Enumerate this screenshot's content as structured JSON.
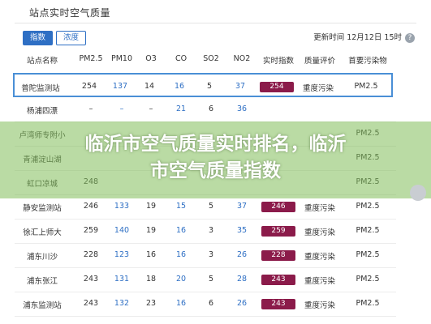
{
  "header": {
    "title": "站点实时空气质量",
    "update_time": "更新时间 12月12日 15时",
    "help_icon": "?"
  },
  "tabs": [
    {
      "label": "指数",
      "active": true
    },
    {
      "label": "浓度",
      "active": false
    }
  ],
  "table": {
    "columns": [
      "站点名称",
      "PM2.5",
      "PM10",
      "O3",
      "CO",
      "SO2",
      "NO2",
      "实时指数",
      "质量评价",
      "首要污染物"
    ],
    "rows": [
      {
        "name": "普陀监测站",
        "pm25": "254",
        "pm10": "137",
        "o3": "14",
        "co": "16",
        "so2": "5",
        "no2": "37",
        "aqi": "254",
        "quality": "重度污染",
        "primary": "PM2.5",
        "highlight": true
      },
      {
        "name": "杨浦四漂",
        "pm25": "–",
        "pm10": "–",
        "o3": "–",
        "co": "21",
        "so2": "6",
        "no2": "36",
        "aqi": "",
        "quality": "",
        "primary": ""
      },
      {
        "name": "卢湾师专附小",
        "pm25": "",
        "pm10": "",
        "o3": "",
        "co": "",
        "so2": "",
        "no2": "",
        "aqi": "",
        "quality": "",
        "primary": "PM2.5"
      },
      {
        "name": "青浦淀山湖",
        "pm25": "",
        "pm10": "",
        "o3": "",
        "co": "",
        "so2": "",
        "no2": "",
        "aqi": "",
        "quality": "",
        "primary": "PM2.5"
      },
      {
        "name": "虹口凉城",
        "pm25": "248",
        "pm10": "",
        "o3": "",
        "co": "",
        "so2": "",
        "no2": "",
        "aqi": "",
        "quality": "",
        "primary": "PM2.5"
      },
      {
        "name": "静安监测站",
        "pm25": "246",
        "pm10": "133",
        "o3": "19",
        "co": "15",
        "so2": "5",
        "no2": "37",
        "aqi": "246",
        "quality": "重度污染",
        "primary": "PM2.5"
      },
      {
        "name": "徐汇上师大",
        "pm25": "259",
        "pm10": "140",
        "o3": "19",
        "co": "16",
        "so2": "3",
        "no2": "35",
        "aqi": "259",
        "quality": "重度污染",
        "primary": "PM2.5"
      },
      {
        "name": "浦东川沙",
        "pm25": "228",
        "pm10": "123",
        "o3": "16",
        "co": "16",
        "so2": "3",
        "no2": "26",
        "aqi": "228",
        "quality": "重度污染",
        "primary": "PM2.5"
      },
      {
        "name": "浦东张江",
        "pm25": "243",
        "pm10": "131",
        "o3": "18",
        "co": "20",
        "so2": "5",
        "no2": "28",
        "aqi": "243",
        "quality": "重度污染",
        "primary": "PM2.5"
      },
      {
        "name": "浦东监测站",
        "pm25": "243",
        "pm10": "132",
        "o3": "23",
        "co": "16",
        "so2": "6",
        "no2": "26",
        "aqi": "243",
        "quality": "重度污染",
        "primary": "PM2.5"
      }
    ]
  },
  "overlay": {
    "line1": "临沂市空气质量实时排名，临沂",
    "line2": "市空气质量指数"
  },
  "colors": {
    "accent": "#2e6fc4",
    "aqi_badge": "#8b1b4a",
    "overlay": "#82be5a"
  }
}
